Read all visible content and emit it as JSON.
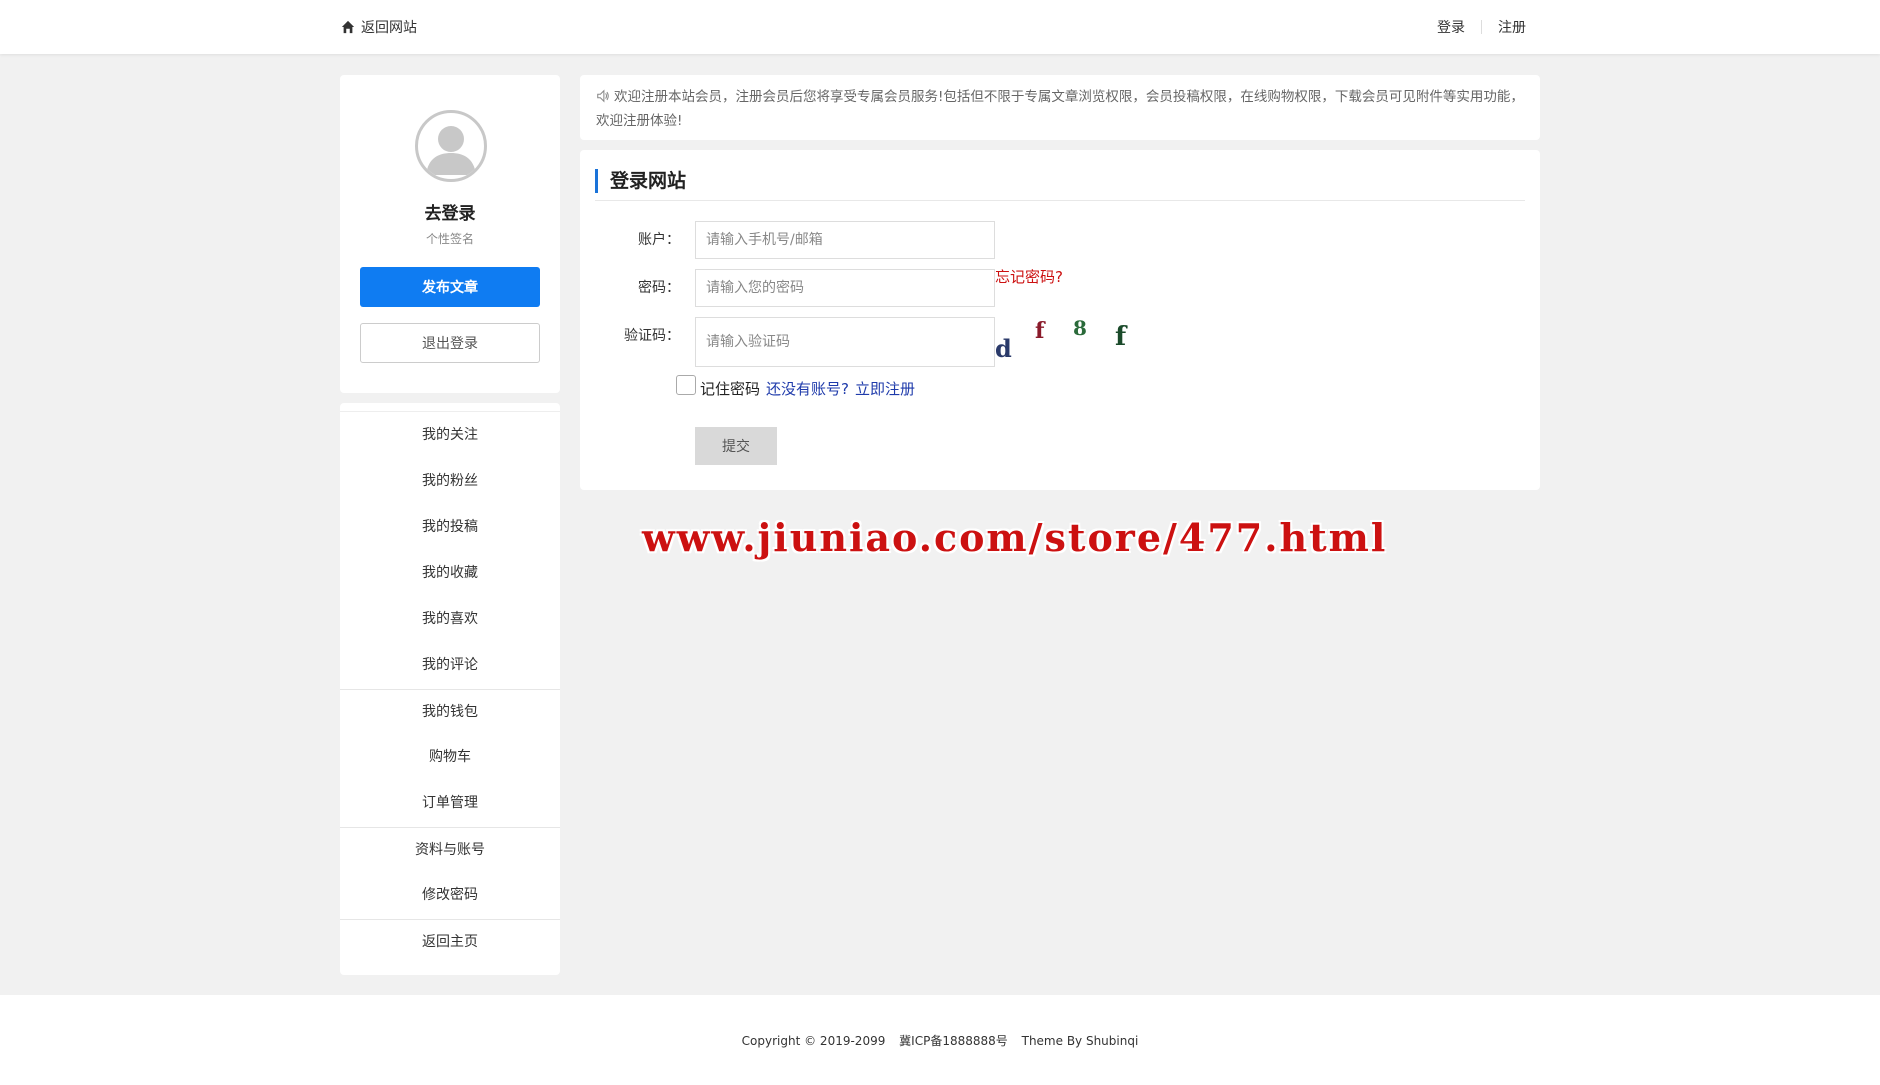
{
  "topbar": {
    "back_label": "返回网站",
    "login_label": "登录",
    "register_label": "注册"
  },
  "profile": {
    "username": "去登录",
    "signature": "个性签名",
    "post_button": "发布文章",
    "logout_button": "退出登录"
  },
  "menu": {
    "items": [
      "我的关注",
      "我的粉丝",
      "我的投稿",
      "我的收藏",
      "我的喜欢",
      "我的评论",
      "我的钱包",
      "购物车",
      "订单管理",
      "资料与账号",
      "修改密码",
      "返回主页"
    ]
  },
  "notice": {
    "text": "欢迎注册本站会员，注册会员后您将享受专属会员服务!包括但不限于专属文章浏览权限，会员投稿权限，在线购物权限，下载会员可见附件等实用功能，欢迎注册体验!"
  },
  "login": {
    "title": "登录网站",
    "account_label": "账户：",
    "account_placeholder": "请输入手机号/邮箱",
    "password_label": "密码：",
    "password_placeholder": "请输入您的密码",
    "forgot_label": "忘记密码?",
    "captcha_label": "验证码：",
    "captcha_placeholder": "请输入验证码",
    "captcha_chars": [
      "d",
      "f",
      "8",
      "f"
    ],
    "remember_label": "记住密码",
    "no_account_label": "还没有账号?",
    "register_now_label": "立即注册",
    "submit_label": "提交"
  },
  "watermark": "www.jiuniao.com/store/477.html",
  "footer": {
    "copyright": "Copyright © 2019-2099",
    "icp": "冀ICP备1888888号",
    "theme": "Theme By Shubinqi"
  },
  "colors": {
    "accent": "#0f7cf2",
    "danger": "#cc1111",
    "link": "#1f3bab",
    "background": "#f1f1f1"
  }
}
